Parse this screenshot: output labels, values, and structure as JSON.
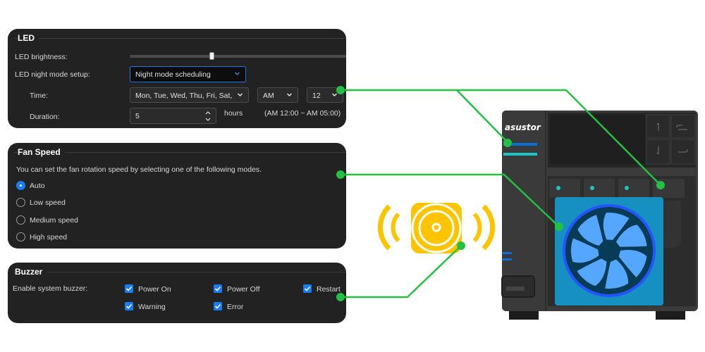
{
  "led": {
    "title": "LED",
    "brightness_label": "LED brightness:",
    "brightness_value": 0.38,
    "night_mode_label": "LED night mode setup:",
    "night_mode_value": "Night mode scheduling",
    "time_label": "Time:",
    "time_days_value": "Mon, Tue, Wed, Thu, Fri, Sat,",
    "time_ampm_value": "AM",
    "time_hour_value": "12",
    "duration_label": "Duration:",
    "duration_value": "5",
    "duration_unit": "hours",
    "duration_range": "(AM 12:00 ~ AM 05:00)"
  },
  "fan": {
    "title": "Fan Speed",
    "description": "You can set the fan rotation speed by selecting one of the following modes.",
    "selected": "Auto",
    "options": [
      "Auto",
      "Low speed",
      "Medium speed",
      "High speed"
    ]
  },
  "buzzer": {
    "title": "Buzzer",
    "label": "Enable system buzzer:",
    "options": [
      {
        "label": "Power On",
        "checked": true
      },
      {
        "label": "Power Off",
        "checked": true
      },
      {
        "label": "Restart",
        "checked": true
      },
      {
        "label": "Warning",
        "checked": true
      },
      {
        "label": "Error",
        "checked": true
      }
    ]
  },
  "device": {
    "brand": "asustor"
  },
  "colors": {
    "callout": "#22c043",
    "accent_blue": "#1a7cf5",
    "speaker": "#ffc400",
    "fan_highlight": "#1596c8",
    "led_blue": "#0a6fd6",
    "led_cyan": "#1ec3c3",
    "panel_bg": "#222222"
  }
}
